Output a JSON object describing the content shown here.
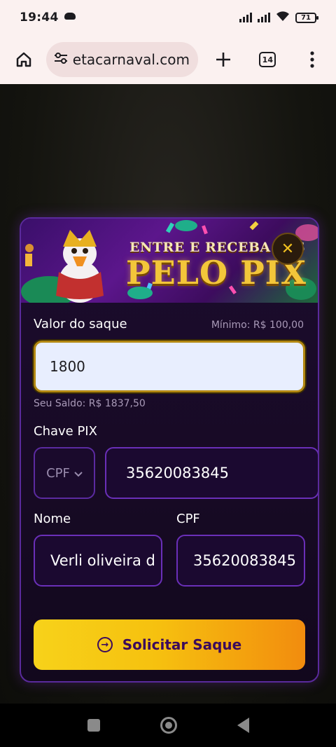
{
  "status_bar": {
    "time": "19:44",
    "battery": "71"
  },
  "browser": {
    "url": "etacarnaval.com",
    "tab_count": "14"
  },
  "banner": {
    "headline": "ENTRE E RECEBA FAS",
    "big_text": "PELO PIX"
  },
  "withdraw_form": {
    "amount_label": "Valor do saque",
    "minimum_text": "Mínimo: R$ 100,00",
    "amount_value": "1800",
    "balance_text": "Seu Saldo: R$ 1837,50",
    "pix_key_label": "Chave PIX",
    "key_type": "CPF",
    "pix_key_value": "35620083845",
    "name_label": "Nome",
    "name_value": "Verli oliveira d",
    "cpf_label": "CPF",
    "cpf_value": "35620083845",
    "submit_label": "Solicitar Saque"
  },
  "colors": {
    "accent_gold": "#f6c10f",
    "accent_orange": "#f28c0e",
    "modal_border": "#5a2a9c",
    "button_text": "#3b0a5c"
  },
  "icons": [
    "cloud-icon",
    "signal-icon",
    "wifi-icon",
    "battery-icon",
    "home-icon",
    "site-settings-icon",
    "new-tab-icon",
    "tabs-icon",
    "menu-icon",
    "close-icon",
    "chevron-down-icon",
    "arrow-circle-icon",
    "recents-icon",
    "home-nav-icon",
    "back-icon"
  ]
}
